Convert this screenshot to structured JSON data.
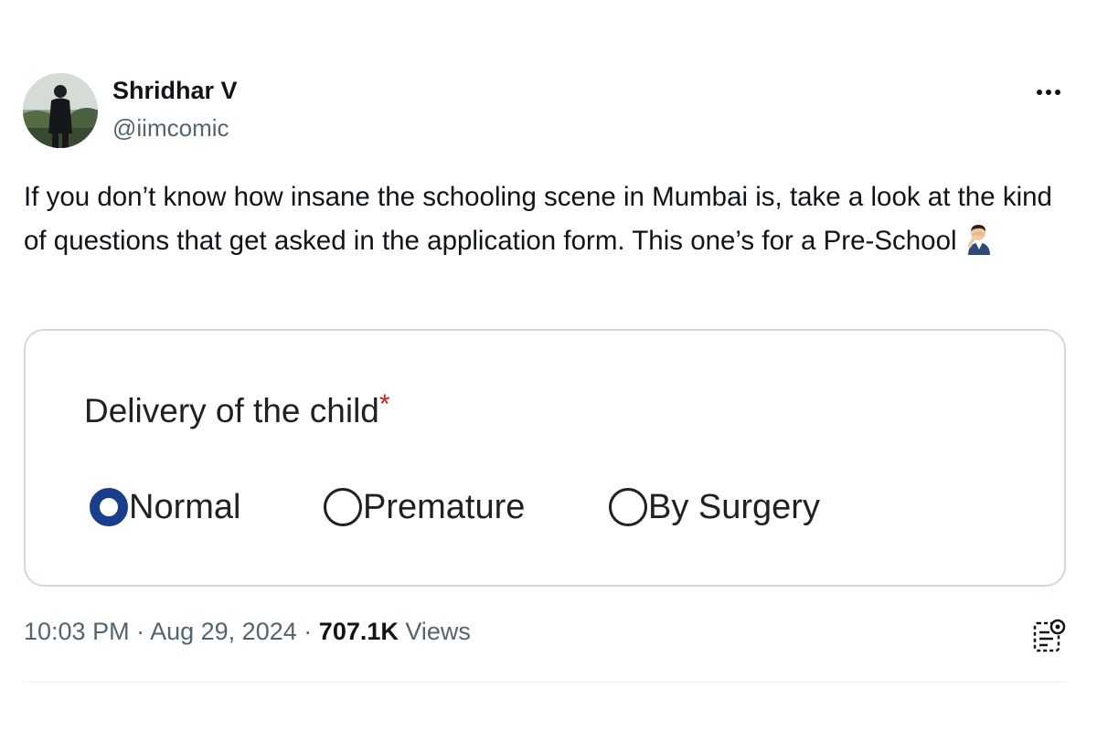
{
  "author": {
    "name": "Shridhar V",
    "handle": "@iimcomic"
  },
  "tweet": {
    "text": "If you don’t know how insane the schooling scene in Mumbai is, take a look at the kind of questions that get asked in the application form. This one’s for a Pre-School",
    "emoji_icon": "man-facepalming-emoji"
  },
  "form": {
    "question": "Delivery of the child",
    "required_marker": "*",
    "options": [
      {
        "label": "Normal",
        "selected": true
      },
      {
        "label": "Premature",
        "selected": false
      },
      {
        "label": "By Surgery",
        "selected": false
      }
    ],
    "accent_color": "#1a3e8c"
  },
  "meta": {
    "time": "10:03 PM",
    "separator": "·",
    "date": "Aug 29, 2024",
    "views_count": "707.1K",
    "views_label": "Views"
  },
  "icons": {
    "more": "more-options-icon",
    "analytics": "view-analytics-icon"
  },
  "colors": {
    "text_primary": "#0f1419",
    "text_secondary": "#536471",
    "border": "#cfd9de",
    "required": "#c5221f"
  }
}
